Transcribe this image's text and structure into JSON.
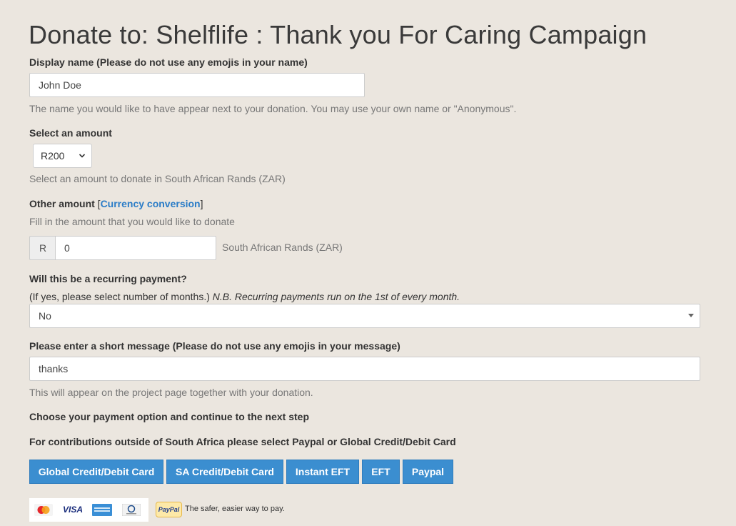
{
  "page": {
    "title": "Donate to: Shelflife : Thank you For Caring Campaign"
  },
  "display_name": {
    "label": "Display name (Please do not use any emojis in your name)",
    "value": "John Doe",
    "help": "The name you would like to have appear next to your donation. You may use your own name or \"Anonymous\"."
  },
  "amount": {
    "label": "Select an amount",
    "selected": "R200",
    "help": "Select an amount to donate in South African Rands (ZAR)"
  },
  "other_amount": {
    "label": "Other amount",
    "bracket_open": "[",
    "link": "Currency conversion",
    "bracket_close": "]",
    "help": "Fill in the amount that you would like to donate",
    "prefix": "R",
    "value": "0",
    "suffix": "South African Rands (ZAR)"
  },
  "recurring": {
    "label": "Will this be a recurring payment?",
    "help_plain": "(If yes, please select number of months.)",
    "help_italic": "N.B. Recurring payments run on the 1st of every month.",
    "selected": "No"
  },
  "message": {
    "label": "Please enter a short message (Please do not use any emojis in your message)",
    "value": "thanks",
    "help": "This will appear on the project page together with your donation."
  },
  "payment": {
    "heading": "Choose your payment option and continue to the next step",
    "note": "For contributions outside of South Africa please select Paypal or Global Credit/Debit Card",
    "buttons": {
      "global_card": "Global Credit/Debit Card",
      "sa_card": "SA Credit/Debit Card",
      "instant_eft": "Instant EFT",
      "eft": "EFT",
      "paypal": "Paypal"
    },
    "card_logos": {
      "visa": "VISA"
    },
    "paypal_badge": "PayPal",
    "paypal_tagline": "The safer, easier way to pay."
  },
  "colors": {
    "background": "#ebe6df",
    "button": "#3b8ed0",
    "link": "#2a7cc7"
  }
}
